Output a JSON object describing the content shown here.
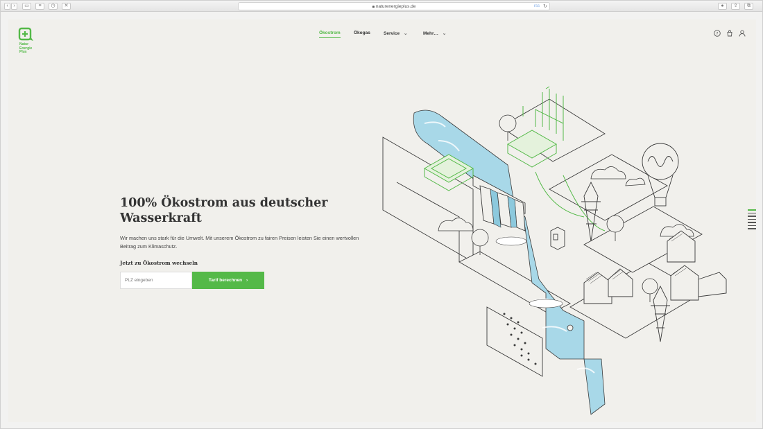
{
  "browser": {
    "url": "naturenergieplus.de",
    "reader_label": "rss"
  },
  "logo": {
    "line1": "Natur",
    "line2": "Energie",
    "line3": "Plus"
  },
  "nav": {
    "items": [
      {
        "label": "Ökostrom",
        "active": true
      },
      {
        "label": "Ökogas",
        "active": false
      },
      {
        "label": "Service",
        "active": false,
        "dropdown": true
      },
      {
        "label": "Mehr…",
        "active": false,
        "dropdown": true
      }
    ]
  },
  "header_icons": [
    "help-icon",
    "cart-icon",
    "user-icon"
  ],
  "hero": {
    "title": "100% Ökostrom aus deutscher Wasserkraft",
    "lead": "Wir machen uns stark für die Umwelt. Mit unserem Ökostrom zu fairen Preisen leisten Sie einen wertvollen Beitrag zum Klimaschutz.",
    "subheading": "Jetzt zu Ökostrom wechseln",
    "plz_placeholder": "PLZ eingeben",
    "cta_label": "Tarif berechnen"
  },
  "colors": {
    "brand": "#54b948",
    "text": "#333333",
    "page_bg": "#f1f0ec",
    "water": "#a8d8e8"
  }
}
